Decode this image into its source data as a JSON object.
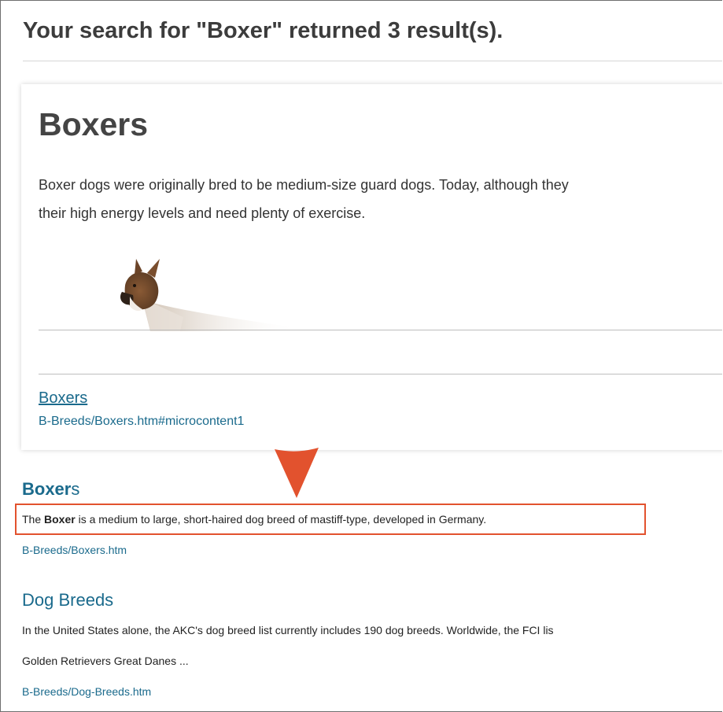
{
  "search": {
    "summary": "Your search for \"Boxer\" returned 3 result(s)."
  },
  "micro": {
    "title": "Boxers",
    "text_line1": "Boxer dogs were originally bred to be medium-size guard dogs. Today, although they",
    "text_line2": "their high energy levels and need plenty of exercise.",
    "link": "Boxers",
    "path": "B-Breeds/Boxers.htm#microcontent1"
  },
  "results": [
    {
      "title_bold": "Boxer",
      "title_rest": "s",
      "text_pre": "The ",
      "text_bold": "Boxer",
      "text_post": " is a medium to large, short-haired dog breed of mastiff-type, developed in Germany.",
      "path": "B-Breeds/Boxers.htm"
    },
    {
      "title": "Dog Breeds",
      "text_line1": "In the United States alone, the AKC's dog breed list currently includes 190 dog breeds. Worldwide, the FCI lis",
      "text_line2": "Golden Retrievers Great Danes ...",
      "path": "B-Breeds/Dog-Breeds.htm"
    }
  ],
  "colors": {
    "link": "#1a6a8c",
    "callout": "#e2522e",
    "heading": "#3c3c3c"
  }
}
